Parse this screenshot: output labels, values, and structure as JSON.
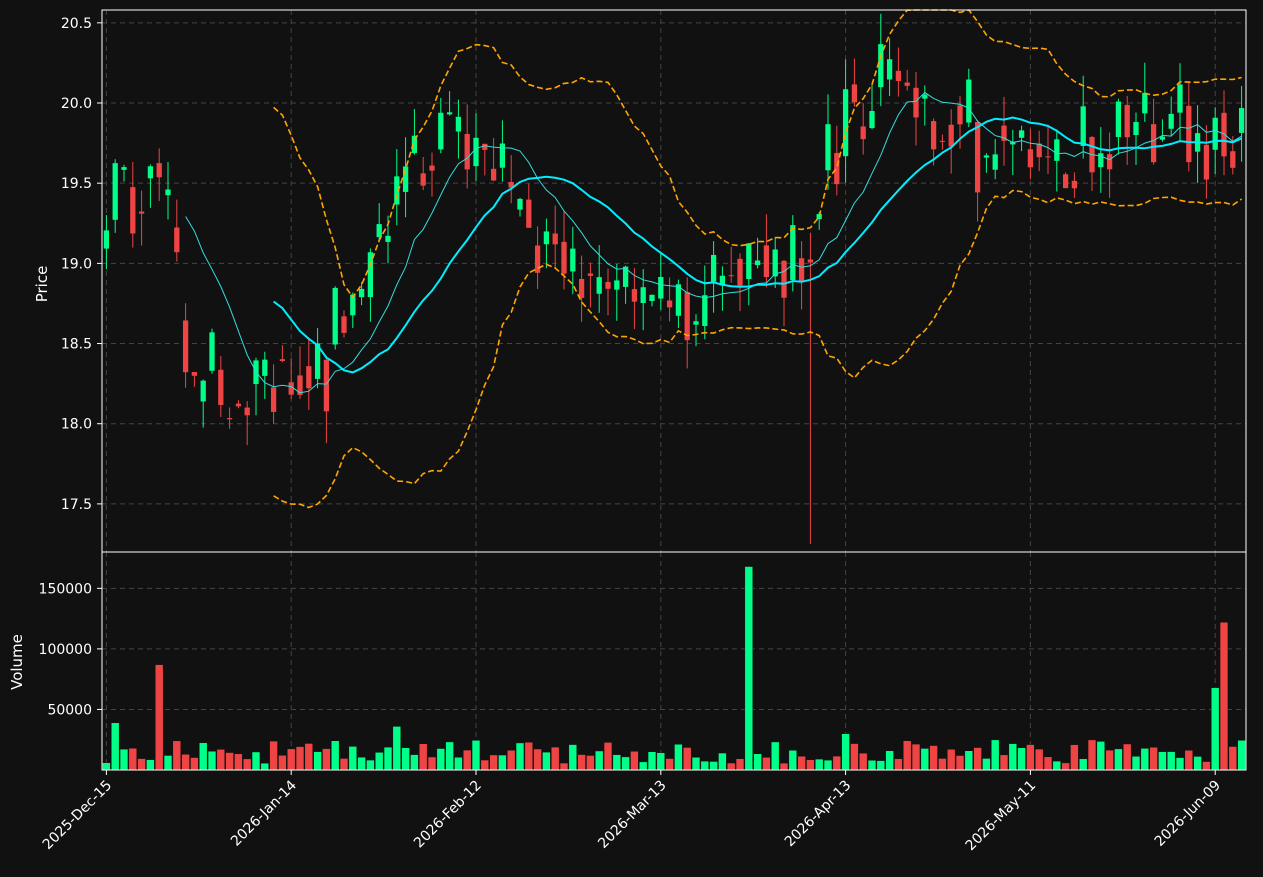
{
  "colors": {
    "background": "#111111",
    "up": "#00ff88",
    "down": "#ee4444",
    "grid": "#444444",
    "frame": "#ffffff",
    "ma_short": "#33dddd",
    "ma_long": "#00eeff",
    "bands": "#ffa500",
    "text": "#ffffff"
  },
  "chart_data": [
    {
      "type": "candlestick",
      "ylabel": "Price",
      "ylim": [
        17.2,
        20.58
      ],
      "yticks": [
        17.5,
        18.0,
        18.5,
        19.0,
        19.5,
        20.0,
        20.5
      ],
      "ytick_labels": [
        "17.5",
        "18.0",
        "18.5",
        "19.0",
        "19.5",
        "20.0",
        "20.5"
      ],
      "grid": true,
      "overlays": [
        "moving-average-short",
        "moving-average-long",
        "upper-band",
        "lower-band"
      ]
    },
    {
      "type": "bar",
      "ylabel": "Volume",
      "ylim": [
        0,
        180000
      ],
      "yticks": [
        50000,
        100000,
        150000
      ],
      "ytick_labels": [
        "50000",
        "100000",
        "150000"
      ],
      "grid": true
    }
  ],
  "x_axis": {
    "tick_labels": [
      "2025-Dec-15",
      "2026-Jan-14",
      "2026-Feb-12",
      "2026-Mar-13",
      "2026-Apr-13",
      "2026-May-11",
      "2026-Jun-09"
    ],
    "tick_index": [
      0,
      21,
      42,
      63,
      84,
      105,
      126
    ],
    "bar_count": 130
  }
}
